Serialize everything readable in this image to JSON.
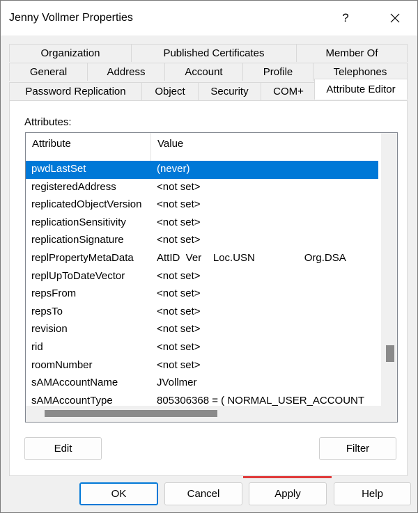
{
  "window": {
    "title": "Jenny Vollmer Properties",
    "help_label": "?"
  },
  "tabs": {
    "row1": [
      "Organization",
      "Published Certificates",
      "Member Of"
    ],
    "row2": [
      "General",
      "Address",
      "Account",
      "Profile",
      "Telephones"
    ],
    "row3": [
      "Password Replication",
      "Object",
      "Security",
      "COM+",
      "Attribute Editor"
    ],
    "active": "Attribute Editor"
  },
  "attributes": {
    "label": "Attributes:",
    "columns": [
      "Attribute",
      "Value"
    ],
    "rows": [
      {
        "attribute": "pwdLastSet",
        "value": "(never)",
        "selected": true
      },
      {
        "attribute": "registeredAddress",
        "value": "<not set>"
      },
      {
        "attribute": "replicatedObjectVersion",
        "value": "<not set>"
      },
      {
        "attribute": "replicationSensitivity",
        "value": "<not set>"
      },
      {
        "attribute": "replicationSignature",
        "value": "<not set>"
      },
      {
        "attribute": "replPropertyMetaData",
        "value": "AttID  Ver    Loc.USN                 Org.DSA"
      },
      {
        "attribute": "replUpToDateVector",
        "value": "<not set>"
      },
      {
        "attribute": "repsFrom",
        "value": "<not set>"
      },
      {
        "attribute": "repsTo",
        "value": "<not set>"
      },
      {
        "attribute": "revision",
        "value": "<not set>"
      },
      {
        "attribute": "rid",
        "value": "<not set>"
      },
      {
        "attribute": "roomNumber",
        "value": "<not set>"
      },
      {
        "attribute": "sAMAccountName",
        "value": "JVollmer"
      },
      {
        "attribute": "sAMAccountType",
        "value": "805306368 = ( NORMAL_USER_ACCOUNT"
      }
    ]
  },
  "buttons": {
    "edit": "Edit",
    "filter": "Filter",
    "ok": "OK",
    "cancel": "Cancel",
    "apply": "Apply",
    "help": "Help"
  },
  "colors": {
    "selection": "#0078d7",
    "highlight_box": "#e03a3a",
    "dialog_bg": "#f0f0f0"
  }
}
